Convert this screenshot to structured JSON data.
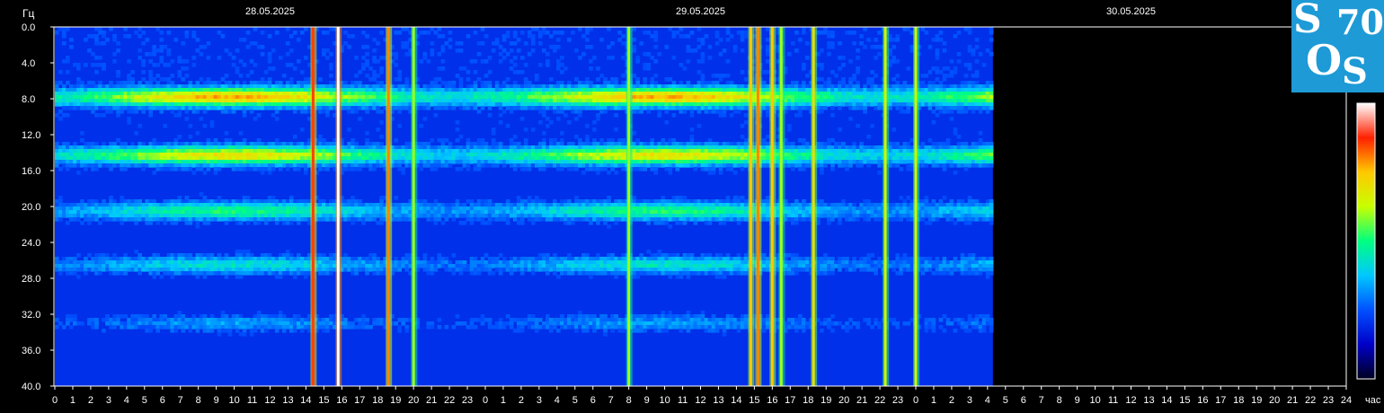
{
  "chart_data": {
    "type": "heatmap",
    "ylabel": "Гц",
    "xlabel": "час",
    "yticks": [
      "0.0",
      "4.0",
      "8.0",
      "12.0",
      "16.0",
      "20.0",
      "24.0",
      "28.0",
      "32.0",
      "36.0",
      "40.0"
    ],
    "ylim": [
      0,
      40
    ],
    "dates": [
      "28.05.2025",
      "29.05.2025",
      "30.05.2025"
    ],
    "hours_per_day": 24,
    "data_end": {
      "date": "30.05.2025",
      "hour": 4.3
    },
    "colorscale": [
      "#000020",
      "#0000c8",
      "#0050ff",
      "#00c8ff",
      "#00ff80",
      "#c8ff00",
      "#ffc800",
      "#ff2000",
      "#ffffff"
    ],
    "bands_hz": [
      {
        "freq": 7.8,
        "level": 0.62
      },
      {
        "freq": 14.3,
        "level": 0.55
      },
      {
        "freq": 20.5,
        "level": 0.35
      },
      {
        "freq": 26.5,
        "level": 0.28
      },
      {
        "freq": 33.0,
        "level": 0.18
      }
    ],
    "bursts": [
      {
        "hour": 14.4,
        "level": 0.85
      },
      {
        "hour": 15.8,
        "level": 1.0
      },
      {
        "hour": 18.6,
        "level": 0.8
      },
      {
        "hour": 20.0,
        "level": 0.6
      },
      {
        "hour": 32.0,
        "level": 0.6
      },
      {
        "hour": 38.8,
        "level": 0.75
      },
      {
        "hour": 39.2,
        "level": 0.8
      },
      {
        "hour": 40.0,
        "level": 0.75
      },
      {
        "hour": 40.5,
        "level": 0.6
      },
      {
        "hour": 42.3,
        "level": 0.7
      },
      {
        "hour": 46.3,
        "level": 0.65
      },
      {
        "hour": 48.0,
        "level": 0.65
      }
    ]
  },
  "logo": {
    "line1": "S",
    "line2": "70",
    "line3": "O",
    "line4": "S"
  }
}
